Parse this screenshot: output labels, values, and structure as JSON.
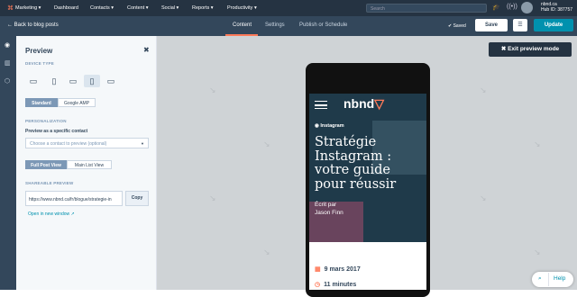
{
  "nav": {
    "logo": "⌘",
    "items": [
      "Marketing ▾",
      "Dashboard",
      "Contacts ▾",
      "Content ▾",
      "Social ▾",
      "Reports ▾",
      "Productivity ▾"
    ],
    "search_placeholder": "Search",
    "account": {
      "name": "nbnd.ca",
      "hub": "Hub ID: 387757"
    }
  },
  "subbar": {
    "back": "Back to blog posts",
    "tabs": [
      "Content",
      "Settings",
      "Publish or Schedule"
    ],
    "saved": "Saved",
    "save": "Save",
    "update": "Update"
  },
  "panel": {
    "title": "Preview",
    "device_type": "DEVICE TYPE",
    "modes": [
      "Standard",
      "Google AMP"
    ],
    "personalization": "PERSONALIZATION",
    "preview_as": "Preview as a specific contact",
    "contact_placeholder": "Choose a contact to preview (optional)",
    "views": [
      "Full Post View",
      "Main List View"
    ],
    "shareable": "SHAREABLE PREVIEW",
    "url": "https://www.nbnd.ca/fr/blogue/strategie-in",
    "copy": "Copy",
    "open_new": "Open in new window"
  },
  "canvas": {
    "exit": "Exit preview mode"
  },
  "post": {
    "brand": "nbnd",
    "category": "Instagram",
    "headline": "Stratégie Instagram : votre guide pour réussir",
    "byline": "Écrit par\nJason Finn",
    "date": "9 mars 2017",
    "read_time": "11 minutes"
  },
  "help": "Help",
  "colors": {
    "accent": "#ff7a59",
    "update": "#0091ae",
    "nav": "#253342"
  }
}
